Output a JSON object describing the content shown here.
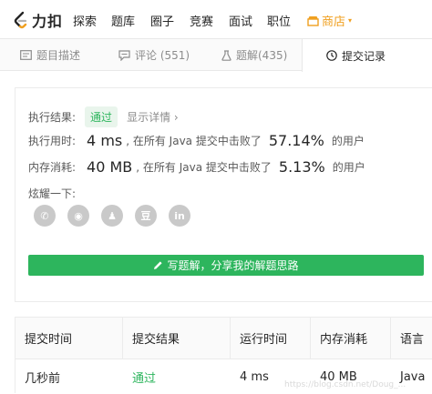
{
  "brand": {
    "name": "力扣",
    "accent": "#2db55d",
    "store_color": "#f0a020"
  },
  "nav": {
    "items": [
      "探索",
      "题库",
      "圈子",
      "竞赛",
      "面试",
      "职位"
    ],
    "store": {
      "label": "商店",
      "icon": "store-icon",
      "caret": "▾"
    }
  },
  "tabs": [
    {
      "label": "题目描述",
      "icon": "description-icon"
    },
    {
      "label": "评论 (551)",
      "icon": "comment-icon"
    },
    {
      "label": "题解(435)",
      "icon": "flask-icon"
    },
    {
      "label": "提交记录",
      "icon": "clock-icon",
      "active": true
    }
  ],
  "result": {
    "status_label": "执行结果:",
    "status": "通过",
    "details_link": "显示详情",
    "details_chevron": "›",
    "runtime_label": "执行用时:",
    "runtime_value": "4 ms",
    "runtime_text": ", 在所有 Java 提交中击败了",
    "runtime_percent": "57.14%",
    "memory_label": "内存消耗:",
    "memory_value": "40 MB",
    "memory_text": ", 在所有 Java 提交中击败了",
    "memory_percent": "5.13%",
    "users_suffix": "的用户",
    "share_label": "炫耀一下:",
    "share_icons": [
      {
        "name": "wechat-icon",
        "glyph": "✆"
      },
      {
        "name": "weibo-icon",
        "glyph": "◉"
      },
      {
        "name": "qq-icon",
        "glyph": "♟"
      },
      {
        "name": "douban-icon",
        "glyph": "豆"
      },
      {
        "name": "linkedin-icon",
        "glyph": "in"
      }
    ],
    "write_button": "写题解，分享我的解题思路",
    "write_button_icon": "pencil-icon"
  },
  "table": {
    "headers": [
      "提交时间",
      "提交结果",
      "运行时间",
      "内存消耗",
      "语言"
    ],
    "rows": [
      [
        "几秒前",
        "通过",
        "4 ms",
        "40 MB",
        "Java"
      ]
    ]
  },
  "watermark": "https://blog.csdn.net/Doug_..."
}
